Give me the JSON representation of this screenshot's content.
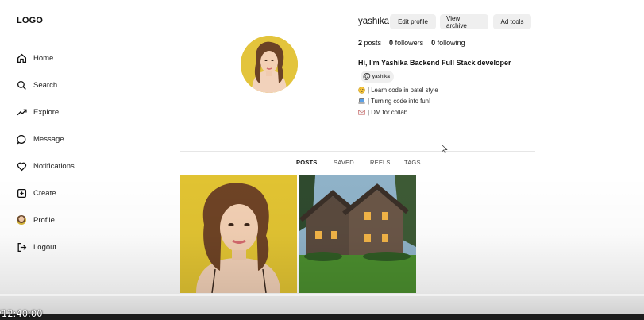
{
  "sidebar": {
    "logo": "LOGO",
    "items": [
      {
        "label": "Home",
        "icon": "home-icon"
      },
      {
        "label": "Search",
        "icon": "search-icon"
      },
      {
        "label": "Explore",
        "icon": "trending-icon"
      },
      {
        "label": "Message",
        "icon": "message-icon"
      },
      {
        "label": "Notifications",
        "icon": "heart-icon"
      },
      {
        "label": "Create",
        "icon": "plus-square-icon"
      },
      {
        "label": "Profile",
        "icon": "avatar-icon"
      },
      {
        "label": "Logout",
        "icon": "logout-icon"
      }
    ]
  },
  "profile": {
    "username": "yashika",
    "buttons": {
      "edit": "Edit profile",
      "archive": "View archive",
      "adtools": "Ad tools"
    },
    "stats": {
      "posts_count": "2",
      "posts_label": "posts",
      "followers_count": "0",
      "followers_label": "followers",
      "following_count": "0",
      "following_label": "following"
    },
    "bio_title": "Hi, I'm Yashika Backend Full Stack developer",
    "handle_chip": "yashika",
    "bio_lines": [
      {
        "emoji": "smiley-face-icon",
        "text": "| Learn code in patel style"
      },
      {
        "emoji": "laptop-icon",
        "text": "| Turning code into fun!"
      },
      {
        "emoji": "envelope-icon",
        "text": "| DM for collab"
      }
    ]
  },
  "tabs": [
    "POSTS",
    "SAVED",
    "REELS",
    "TAGS"
  ],
  "active_tab": "POSTS",
  "video_overlay": {
    "timestamp": "12:40:00"
  }
}
